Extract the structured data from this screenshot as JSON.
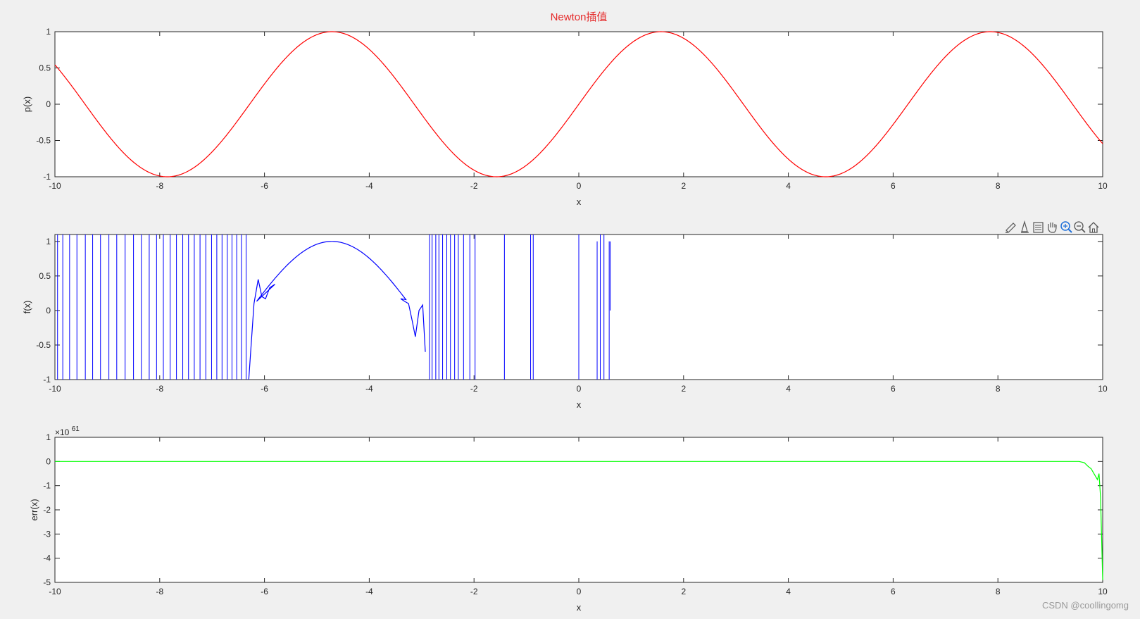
{
  "figure": {
    "background": "#f0f0f0",
    "watermark": "CSDN @coollingomg"
  },
  "toolbar": {
    "icons": [
      "brush-icon",
      "datatip-icon",
      "legend-icon",
      "pan-icon",
      "zoom-in-icon",
      "zoom-out-icon",
      "home-icon"
    ]
  },
  "chart_data": [
    {
      "type": "line",
      "title": "Newton插值",
      "xlabel": "x",
      "ylabel": "p(x)",
      "xlim": [
        -10,
        10
      ],
      "ylim": [
        -1,
        1
      ],
      "xticks": [
        -10,
        -8,
        -6,
        -4,
        -2,
        0,
        2,
        4,
        6,
        8,
        10
      ],
      "yticks": [
        -1,
        -0.5,
        0,
        0.5,
        1
      ],
      "grid": false,
      "series": [
        {
          "color": "#ff0000",
          "function": "sin(x)",
          "x_range": [
            -10,
            10
          ]
        }
      ]
    },
    {
      "type": "line",
      "title": "",
      "xlabel": "x",
      "ylabel": "f(x)",
      "xlim": [
        -10,
        10
      ],
      "ylim": [
        -1,
        1.1
      ],
      "xticks": [
        -10,
        -8,
        -6,
        -4,
        -2,
        0,
        2,
        4,
        6,
        8,
        10
      ],
      "yticks": [
        -1,
        -0.5,
        0,
        0.5,
        1
      ],
      "grid": false,
      "series": [
        {
          "color": "#0000ff",
          "smooth_segment": {
            "function": "sin(x)",
            "x_range": [
              -6.15,
              -3.3
            ]
          },
          "wiggle_left": [
            [
              -6.3,
              -1.0
            ],
            [
              -6.2,
              0.1
            ],
            [
              -6.12,
              0.45
            ],
            [
              -6.05,
              0.2
            ],
            [
              -5.98,
              0.17
            ],
            [
              -5.9,
              0.33
            ],
            [
              -5.8,
              0.38
            ]
          ],
          "wiggle_right": [
            [
              -3.4,
              0.17
            ],
            [
              -3.32,
              0.13
            ],
            [
              -3.25,
              0.1
            ],
            [
              -3.18,
              -0.15
            ],
            [
              -3.12,
              -0.38
            ],
            [
              -3.05,
              0.0
            ],
            [
              -2.98,
              0.08
            ],
            [
              -2.93,
              -0.6
            ]
          ],
          "spikes_left": [
            -9.95,
            -9.85,
            -9.72,
            -9.58,
            -9.42,
            -9.28,
            -9.13,
            -8.97,
            -8.82,
            -8.66,
            -8.5,
            -8.35,
            -8.2,
            -8.06,
            -7.93,
            -7.8,
            -7.68,
            -7.56,
            -7.45,
            -7.34,
            -7.23,
            -7.12,
            -7.01,
            -6.91,
            -6.81,
            -6.71,
            -6.62,
            -6.53,
            -6.44,
            -6.35
          ],
          "spikes_right": [
            -2.85,
            -2.8,
            -2.73,
            -2.67,
            -2.6,
            -2.52,
            -2.45,
            -2.37,
            -2.3,
            -2.2,
            -2.08,
            -1.98,
            -1.42,
            -0.92,
            -0.87,
            0.0
          ],
          "spikes_tail": [
            [
              0.35,
              1.0
            ],
            [
              0.41,
              1.1
            ],
            [
              0.48,
              1.1
            ],
            [
              0.58,
              1.0
            ]
          ],
          "end_point": [
            0.6,
            0.0
          ]
        }
      ]
    },
    {
      "type": "line",
      "title": "",
      "xlabel": "x",
      "ylabel": "err(x)",
      "xlim": [
        -10,
        10
      ],
      "ylim": [
        -5,
        1
      ],
      "exponent_label": "×10",
      "exponent_value": "61",
      "xticks": [
        -10,
        -8,
        -6,
        -4,
        -2,
        0,
        2,
        4,
        6,
        8,
        10
      ],
      "yticks": [
        -5,
        -4,
        -3,
        -2,
        -1,
        0,
        1
      ],
      "grid": false,
      "series": [
        {
          "color": "#00ff00",
          "x": [
            -10,
            9.55,
            9.65,
            9.72,
            9.78,
            9.82,
            9.86,
            9.9,
            9.93,
            9.96,
            9.98,
            10.0
          ],
          "y": [
            0,
            0,
            -0.05,
            -0.2,
            -0.3,
            -0.45,
            -0.6,
            -0.75,
            -0.5,
            -1.5,
            -3.2,
            -4.9
          ]
        }
      ]
    }
  ]
}
